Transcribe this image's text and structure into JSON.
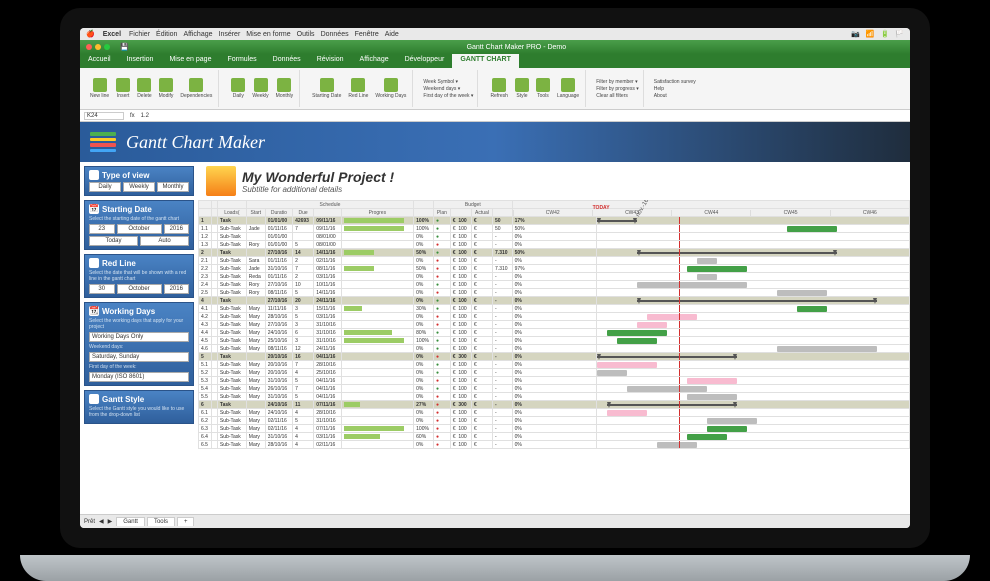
{
  "mac_menu": {
    "app": "Excel",
    "items": [
      "Fichier",
      "Édition",
      "Affichage",
      "Insérer",
      "Mise en forme",
      "Outils",
      "Données",
      "Fenêtre",
      "Aide"
    ]
  },
  "window_title": "Gantt Chart Maker PRO - Demo",
  "tabs": [
    "Accueil",
    "Insertion",
    "Mise en page",
    "Formules",
    "Données",
    "Révision",
    "Affichage",
    "Développeur",
    "GANTT CHART"
  ],
  "ribbon": {
    "g1": [
      "New line",
      "Insert",
      "Delete",
      "Modify",
      "Dependencies"
    ],
    "g2": [
      "Daily",
      "Weekly",
      "Monthly"
    ],
    "g3": [
      "Starting Date",
      "Red Line",
      "Working Days"
    ],
    "g4_side": [
      "Week Symbol ▾",
      "Weekend days ▾",
      "First day of the week ▾"
    ],
    "g5": [
      "Refresh",
      "Style",
      "Tools",
      "Language"
    ],
    "g6_side": [
      "Filter by member ▾",
      "Filter by progress ▾",
      "Clear all filters"
    ],
    "g7_side": [
      "Satisfaction survey",
      "Help",
      "About"
    ]
  },
  "formula": {
    "ref": "K24",
    "fx": "fx",
    "val": "1.2"
  },
  "banner_title": "Gantt Chart Maker",
  "side": {
    "view": {
      "title": "Type of view",
      "opts": [
        "Daily",
        "Weekly",
        "Monthly"
      ]
    },
    "start": {
      "title": "Starting Date",
      "sub": "Select the starting date of the gantt chart",
      "day": "23",
      "month": "October",
      "year": "2016",
      "btns": [
        "Today",
        "Auto"
      ]
    },
    "redline": {
      "title": "Red Line",
      "sub": "Select the date that will be shown with a red line in the gantt chart",
      "day": "30",
      "month": "October",
      "year": "2016"
    },
    "working": {
      "title": "Working Days",
      "sub": "Select the working days that apply for your project",
      "mode": "Working Days Only",
      "wlabel": "Weekend days:",
      "weekend": "Saturday, Sunday",
      "flabel": "First day of the week:",
      "firstday": "Monday (ISO 8601)"
    },
    "style": {
      "title": "Gantt Style",
      "sub": "Select the Gantt style you would like to use from the drop-down list"
    }
  },
  "project": {
    "title": "My Wonderful Project !",
    "sub": "Subtitle for additional details"
  },
  "headers": {
    "schedule": "Schedule",
    "budget": "Budget",
    "today": "TODAY",
    "month": "nov.-16"
  },
  "cols": [
    "",
    "",
    "Loads(",
    "Start",
    "Duratio",
    "Due",
    "",
    "Progres",
    "",
    "Plan",
    "",
    "Actual",
    ""
  ],
  "week_hdr": [
    "CW42",
    "CW43",
    "CW44",
    "CW45",
    "CW46"
  ],
  "rows": [
    {
      "g": true,
      "n": "1",
      "task": "Task",
      "load": "",
      "start": "01/01/00",
      "dur": "42693",
      "due": "09/11/16",
      "prog": "100%",
      "pbar": 60,
      "plan": "100",
      "act": "50",
      "pct": "17%",
      "cs": 0,
      "cw": 40,
      "clr": "bg-b"
    },
    {
      "n": "1.1",
      "task": "Sub-Task",
      "load": "Jade",
      "start": "01/11/16",
      "dur": "7",
      "due": "09/11/16",
      "prog": "100%",
      "pbar": 60,
      "plan": "100",
      "act": "50",
      "pct": "50%",
      "cs": 190,
      "cw": 50,
      "clr": "bg-g"
    },
    {
      "n": "1.2",
      "task": "Sub-Task",
      "load": "",
      "start": "01/01/00",
      "dur": "",
      "due": "08/01/00",
      "prog": "0%",
      "pbar": 0,
      "plan": "100",
      "act": "",
      "pct": "0%",
      "cs": 0,
      "cw": 0,
      "clr": ""
    },
    {
      "n": "1.3",
      "task": "Sub-Task",
      "load": "Rory",
      "start": "01/01/00",
      "dur": "5",
      "due": "08/01/00",
      "prog": "0%",
      "pbar": 0,
      "plan": "100",
      "act": "",
      "pct": "0%",
      "cs": 0,
      "cw": 0,
      "clr": ""
    },
    {
      "g": true,
      "n": "2",
      "task": "Task",
      "load": "",
      "start": "27/10/16",
      "dur": "14",
      "due": "14/11/16",
      "prog": "50%",
      "pbar": 30,
      "plan": "100",
      "act": "7.310",
      "pct": "50%",
      "cs": 40,
      "cw": 200,
      "clr": ""
    },
    {
      "n": "2.1",
      "task": "Sub-Task",
      "load": "Sara",
      "start": "01/11/16",
      "dur": "2",
      "due": "02/11/16",
      "prog": "0%",
      "pbar": 0,
      "plan": "100",
      "act": "",
      "pct": "0%",
      "cs": 100,
      "cw": 20,
      "clr": "bg-gr"
    },
    {
      "n": "2.2",
      "task": "Sub-Task",
      "load": "Jade",
      "start": "31/10/16",
      "dur": "7",
      "due": "08/11/16",
      "prog": "50%",
      "pbar": 30,
      "plan": "100",
      "act": "7.310",
      "pct": "97%",
      "cs": 90,
      "cw": 60,
      "clr": "bg-g"
    },
    {
      "n": "2.3",
      "task": "Sub-Task",
      "load": "Reda",
      "start": "01/11/16",
      "dur": "2",
      "due": "03/11/16",
      "prog": "0%",
      "pbar": 0,
      "plan": "100",
      "act": "",
      "pct": "0%",
      "cs": 100,
      "cw": 20,
      "clr": "bg-gr"
    },
    {
      "n": "2.4",
      "task": "Sub-Task",
      "load": "Rory",
      "start": "27/10/16",
      "dur": "10",
      "due": "10/11/16",
      "prog": "0%",
      "pbar": 0,
      "plan": "100",
      "act": "",
      "pct": "0%",
      "cs": 40,
      "cw": 110,
      "clr": "bg-gr"
    },
    {
      "n": "2.5",
      "task": "Sub-Task",
      "load": "Rory",
      "start": "08/11/16",
      "dur": "5",
      "due": "14/11/16",
      "prog": "0%",
      "pbar": 0,
      "plan": "100",
      "act": "",
      "pct": "0%",
      "cs": 180,
      "cw": 50,
      "clr": "bg-gr"
    },
    {
      "g": true,
      "n": "4",
      "task": "Task",
      "load": "",
      "start": "27/10/16",
      "dur": "20",
      "due": "24/11/16",
      "prog": "0%",
      "pbar": 0,
      "plan": "100",
      "act": "",
      "pct": "0%",
      "cs": 40,
      "cw": 240,
      "clr": ""
    },
    {
      "n": "4.1",
      "task": "Sub-Task",
      "load": "Mary",
      "start": "11/11/16",
      "dur": "3",
      "due": "15/11/16",
      "prog": "30%",
      "pbar": 18,
      "plan": "100",
      "act": "",
      "pct": "0%",
      "cs": 200,
      "cw": 30,
      "clr": "bg-g"
    },
    {
      "n": "4.2",
      "task": "Sub-Task",
      "load": "Mary",
      "start": "28/10/16",
      "dur": "5",
      "due": "03/11/16",
      "prog": "0%",
      "pbar": 0,
      "plan": "100",
      "act": "",
      "pct": "0%",
      "cs": 50,
      "cw": 50,
      "clr": "bg-p"
    },
    {
      "n": "4.3",
      "task": "Sub-Task",
      "load": "Mary",
      "start": "27/10/16",
      "dur": "3",
      "due": "31/10/16",
      "prog": "0%",
      "pbar": 0,
      "plan": "100",
      "act": "",
      "pct": "0%",
      "cs": 40,
      "cw": 30,
      "clr": "bg-p"
    },
    {
      "n": "4.4",
      "task": "Sub-Task",
      "load": "Mary",
      "start": "24/10/16",
      "dur": "6",
      "due": "31/10/16",
      "prog": "80%",
      "pbar": 48,
      "plan": "100",
      "act": "",
      "pct": "0%",
      "cs": 10,
      "cw": 60,
      "clr": "bg-g"
    },
    {
      "n": "4.5",
      "task": "Sub-Task",
      "load": "Mary",
      "start": "25/10/16",
      "dur": "3",
      "due": "31/10/16",
      "prog": "100%",
      "pbar": 60,
      "plan": "100",
      "act": "",
      "pct": "0%",
      "cs": 20,
      "cw": 40,
      "clr": "bg-g"
    },
    {
      "n": "4.6",
      "task": "Sub-Task",
      "load": "Mary",
      "start": "08/11/16",
      "dur": "12",
      "due": "24/11/16",
      "prog": "0%",
      "pbar": 0,
      "plan": "100",
      "act": "",
      "pct": "0%",
      "cs": 180,
      "cw": 100,
      "clr": "bg-gr"
    },
    {
      "g": true,
      "n": "5",
      "task": "Task",
      "load": "",
      "start": "20/10/16",
      "dur": "16",
      "due": "04/11/16",
      "prog": "0%",
      "pbar": 0,
      "plan": "300",
      "act": "",
      "pct": "0%",
      "cs": 0,
      "cw": 140,
      "clr": ""
    },
    {
      "n": "5.1",
      "task": "Sub-Task",
      "load": "Mary",
      "start": "20/10/16",
      "dur": "7",
      "due": "28/10/16",
      "prog": "0%",
      "pbar": 0,
      "plan": "100",
      "act": "",
      "pct": "0%",
      "cs": 0,
      "cw": 60,
      "clr": "bg-p"
    },
    {
      "n": "5.2",
      "task": "Sub-Task",
      "load": "Mary",
      "start": "20/10/16",
      "dur": "4",
      "due": "25/10/16",
      "prog": "0%",
      "pbar": 0,
      "plan": "100",
      "act": "",
      "pct": "0%",
      "cs": 0,
      "cw": 30,
      "clr": "bg-gr"
    },
    {
      "n": "5.3",
      "task": "Sub-Task",
      "load": "Mary",
      "start": "31/10/16",
      "dur": "5",
      "due": "04/11/16",
      "prog": "0%",
      "pbar": 0,
      "plan": "100",
      "act": "",
      "pct": "0%",
      "cs": 90,
      "cw": 50,
      "clr": "bg-p"
    },
    {
      "n": "5.4",
      "task": "Sub-Task",
      "load": "Mary",
      "start": "26/10/16",
      "dur": "7",
      "due": "04/11/16",
      "prog": "0%",
      "pbar": 0,
      "plan": "100",
      "act": "",
      "pct": "0%",
      "cs": 30,
      "cw": 80,
      "clr": "bg-gr"
    },
    {
      "n": "5.5",
      "task": "Sub-Task",
      "load": "Mary",
      "start": "31/10/16",
      "dur": "5",
      "due": "04/11/16",
      "prog": "0%",
      "pbar": 0,
      "plan": "100",
      "act": "",
      "pct": "0%",
      "cs": 90,
      "cw": 50,
      "clr": "bg-gr"
    },
    {
      "g": true,
      "n": "6",
      "task": "Task",
      "load": "",
      "start": "24/10/16",
      "dur": "11",
      "due": "07/11/16",
      "prog": "27%",
      "pbar": 16,
      "plan": "300",
      "act": "",
      "pct": "0%",
      "cs": 10,
      "cw": 130,
      "clr": ""
    },
    {
      "n": "6.1",
      "task": "Sub-Task",
      "load": "Mary",
      "start": "24/10/16",
      "dur": "4",
      "due": "28/10/16",
      "prog": "0%",
      "pbar": 0,
      "plan": "100",
      "act": "",
      "pct": "0%",
      "cs": 10,
      "cw": 40,
      "clr": "bg-p"
    },
    {
      "n": "6.2",
      "task": "Sub-Task",
      "load": "Mary",
      "start": "02/11/16",
      "dur": "5",
      "due": "31/10/16",
      "prog": "0%",
      "pbar": 0,
      "plan": "100",
      "act": "",
      "pct": "0%",
      "cs": 110,
      "cw": 50,
      "clr": "bg-gr"
    },
    {
      "n": "6.3",
      "task": "Sub-Task",
      "load": "Mary",
      "start": "02/11/16",
      "dur": "4",
      "due": "07/11/16",
      "prog": "100%",
      "pbar": 60,
      "plan": "100",
      "act": "",
      "pct": "0%",
      "cs": 110,
      "cw": 40,
      "clr": "bg-g"
    },
    {
      "n": "6.4",
      "task": "Sub-Task",
      "load": "Mary",
      "start": "31/10/16",
      "dur": "4",
      "due": "03/11/16",
      "prog": "60%",
      "pbar": 36,
      "plan": "100",
      "act": "",
      "pct": "0%",
      "cs": 90,
      "cw": 40,
      "clr": "bg-g"
    },
    {
      "n": "6.5",
      "task": "Sub-Task",
      "load": "Mary",
      "start": "28/10/16",
      "dur": "4",
      "due": "02/11/16",
      "prog": "0%",
      "pbar": 0,
      "plan": "100",
      "act": "",
      "pct": "0%",
      "cs": 60,
      "cw": 40,
      "clr": "bg-gr"
    }
  ],
  "sheet_tabs": [
    "Gantt",
    "Tools",
    "+"
  ],
  "status_label": "Prêt"
}
